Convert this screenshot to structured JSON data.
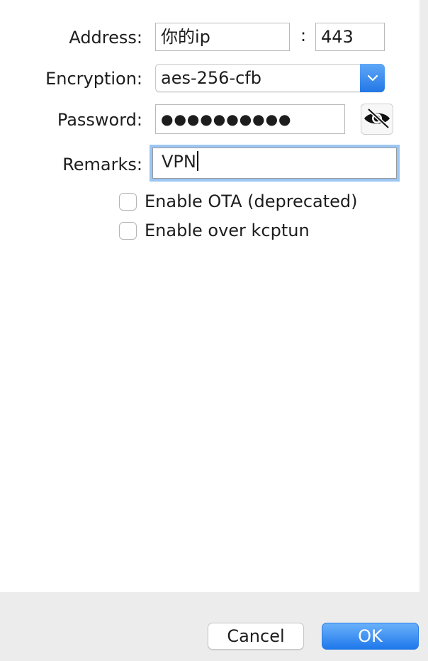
{
  "form": {
    "address_label": "Address:",
    "address_value": "你的ip",
    "port_separator": ":",
    "port_value": "443",
    "encryption_label": "Encryption:",
    "encryption_value": "aes-256-cfb",
    "password_label": "Password:",
    "password_value": "●●●●●●●●●●",
    "remarks_label": "Remarks:",
    "remarks_value": "VPN",
    "ota_label": "Enable OTA (deprecated)",
    "ota_checked": false,
    "kcptun_label": "Enable over kcptun",
    "kcptun_checked": false
  },
  "buttons": {
    "cancel_label": "Cancel",
    "ok_label": "OK"
  },
  "icons": {
    "select_arrow": "chevron-down-icon",
    "password_toggle": "eye-slash-icon"
  },
  "colors": {
    "accent": "#2377e6",
    "focus_ring": "#9cc6f3"
  }
}
